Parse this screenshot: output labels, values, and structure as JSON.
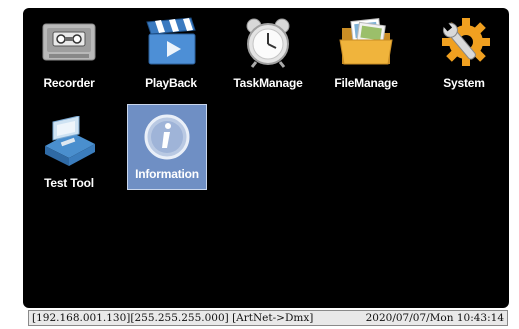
{
  "menu": {
    "items": [
      {
        "label": "Recorder",
        "icon": "tape-recorder-icon"
      },
      {
        "label": "PlayBack",
        "icon": "clapperboard-icon"
      },
      {
        "label": "TaskManage",
        "icon": "alarm-clock-icon"
      },
      {
        "label": "FileManage",
        "icon": "folder-icon"
      },
      {
        "label": "System",
        "icon": "gear-wrench-icon"
      },
      {
        "label": "Test Tool",
        "icon": "toolbox-icon"
      },
      {
        "label": "Information",
        "icon": "info-icon",
        "selected": true
      }
    ]
  },
  "status_bar": {
    "network": "[192.168.001.130][255.255.255.000] [ArtNet->Dmx]",
    "datetime": "2020/07/07/Mon 10:43:14"
  },
  "colors": {
    "screen_bg": "#000000",
    "selection": "#6f8fc4",
    "label": "#ffffff"
  }
}
